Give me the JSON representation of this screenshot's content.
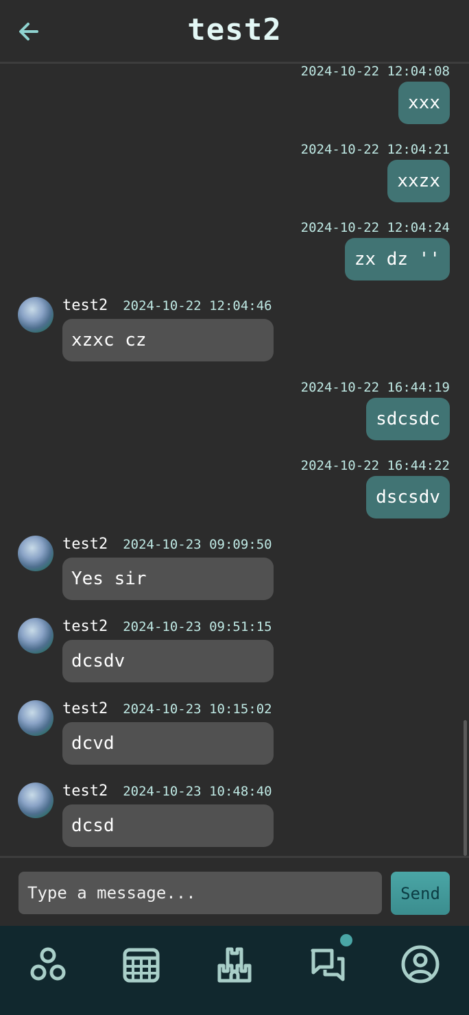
{
  "header": {
    "title": "test2",
    "back_icon": "arrow-left-icon"
  },
  "messages": [
    {
      "direction": "out",
      "timestamp": "2024-10-22 12:04:08",
      "text": "xxx"
    },
    {
      "direction": "out",
      "timestamp": "2024-10-22 12:04:21",
      "text": "xxzx"
    },
    {
      "direction": "out",
      "timestamp": "2024-10-22 12:04:24",
      "text": "zx dz ''"
    },
    {
      "direction": "in",
      "sender": "test2",
      "timestamp": "2024-10-22 12:04:46",
      "text": "xzxc cz"
    },
    {
      "direction": "out",
      "timestamp": "2024-10-22 16:44:19",
      "text": "sdcsdc"
    },
    {
      "direction": "out",
      "timestamp": "2024-10-22 16:44:22",
      "text": "dscsdv"
    },
    {
      "direction": "in",
      "sender": "test2",
      "timestamp": "2024-10-23 09:09:50",
      "text": "Yes sir"
    },
    {
      "direction": "in",
      "sender": "test2",
      "timestamp": "2024-10-23 09:51:15",
      "text": "dcsdv"
    },
    {
      "direction": "in",
      "sender": "test2",
      "timestamp": "2024-10-23 10:15:02",
      "text": "dcvd"
    },
    {
      "direction": "in",
      "sender": "test2",
      "timestamp": "2024-10-23 10:48:40",
      "text": "dcsd"
    }
  ],
  "composer": {
    "placeholder": "Type a message...",
    "value": "",
    "send_label": "Send"
  },
  "nav": {
    "items": [
      {
        "icon": "groups-icon"
      },
      {
        "icon": "calendar-icon"
      },
      {
        "icon": "castle-icon"
      },
      {
        "icon": "chat-icon",
        "has_badge": true
      },
      {
        "icon": "profile-icon"
      }
    ]
  },
  "colors": {
    "background": "#2c2c2c",
    "outgoing_bubble": "#417474",
    "incoming_bubble": "#515151",
    "accent": "#4aa6a6",
    "timestamp": "#bfe9e4",
    "nav_background": "#11282e"
  }
}
